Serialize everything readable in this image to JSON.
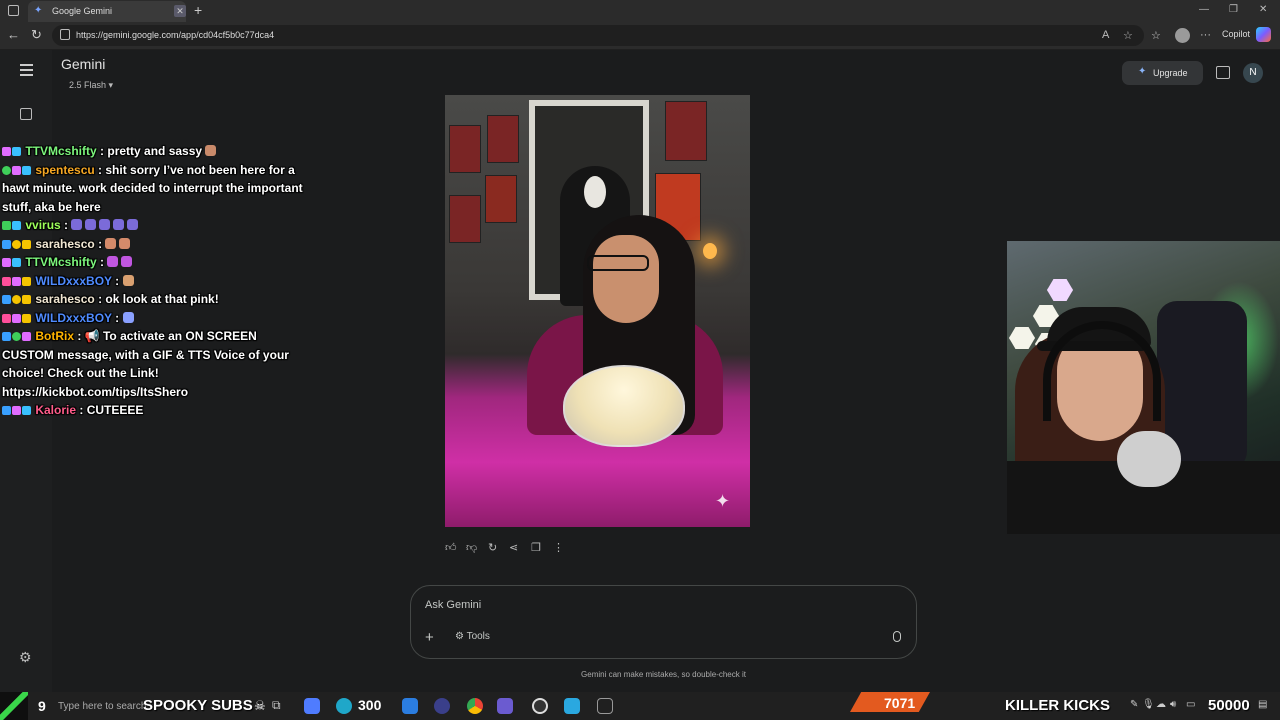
{
  "browser": {
    "tab_title": "Google Gemini",
    "url": "https://gemini.google.com/app/cd04cf5b0c77dca4",
    "copilot_label": "Copilot"
  },
  "gemini": {
    "title": "Gemini",
    "model": "2.5 Flash",
    "upgrade_label": "Upgrade",
    "avatar_letter": "N",
    "input_placeholder": "Ask Gemini",
    "tools_label": "Tools",
    "disclaimer": "Gemini can make mistakes, so double-check it"
  },
  "chat": {
    "messages": [
      {
        "user": "TTVMcshifty",
        "user_color": "#7cf57c",
        "text": ": pretty and sassy"
      },
      {
        "user": "spentescu",
        "user_color": "#f5a623",
        "text": ": shit sorry I’ve not been here for a hawt minute. work decided to interrupt the important stuff, aka be here"
      },
      {
        "user": "vvirus",
        "user_color": "#9dff5a",
        "text": ":"
      },
      {
        "user": "sarahesco",
        "user_color": "#f0e6d2",
        "text": ":"
      },
      {
        "user": "TTVMcshifty",
        "user_color": "#7cf57c",
        "text": ":"
      },
      {
        "user": "WILDxxxBOY",
        "user_color": "#4f8bff",
        "text": ":"
      },
      {
        "user": "sarahesco",
        "user_color": "#f0e6d2",
        "text": ": ok look at that pink!"
      },
      {
        "user": "WILDxxxBOY",
        "user_color": "#4f8bff",
        "text": ":"
      },
      {
        "user": "BotRix",
        "user_color": "#ffb400",
        "text": ": 📢 To activate an ON SCREEN CUSTOM message, with a GIF & TTS Voice of your choice! Check out the Link! https://kickbot.com/tips/ItsShero"
      },
      {
        "user": "Kalorie",
        "user_color": "#ff5c8a",
        "text": ": CUTEEEE"
      }
    ]
  },
  "taskbar": {
    "start_number": "9",
    "search_placeholder": "Type here to search",
    "spooky_label": "SPOOKY SUBS",
    "count_300": "300",
    "orange_count": "7071",
    "killer_label": "KILLER KICKS",
    "big_count": "50000"
  }
}
